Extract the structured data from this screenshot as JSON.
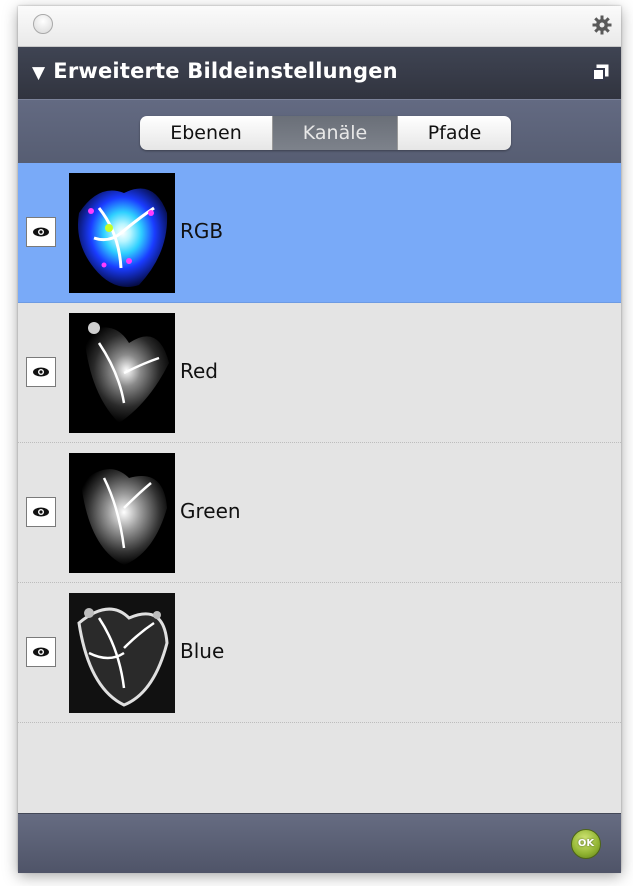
{
  "panel": {
    "title": "Erweiterte Bildeinstellungen"
  },
  "tabs": [
    {
      "label": "Ebenen",
      "active": false
    },
    {
      "label": "Kanäle",
      "active": true
    },
    {
      "label": "Pfade",
      "active": false
    }
  ],
  "channels": [
    {
      "name": "RGB",
      "visible": true,
      "selected": true
    },
    {
      "name": "Red",
      "visible": true,
      "selected": false
    },
    {
      "name": "Green",
      "visible": true,
      "selected": false
    },
    {
      "name": "Blue",
      "visible": true,
      "selected": false
    }
  ],
  "footer": {
    "ok_label": "OK"
  },
  "colors": {
    "selection": "#79aaf8",
    "header": "#35394a",
    "tabbar": "#5e6579",
    "ok_green": "#8fb230"
  }
}
